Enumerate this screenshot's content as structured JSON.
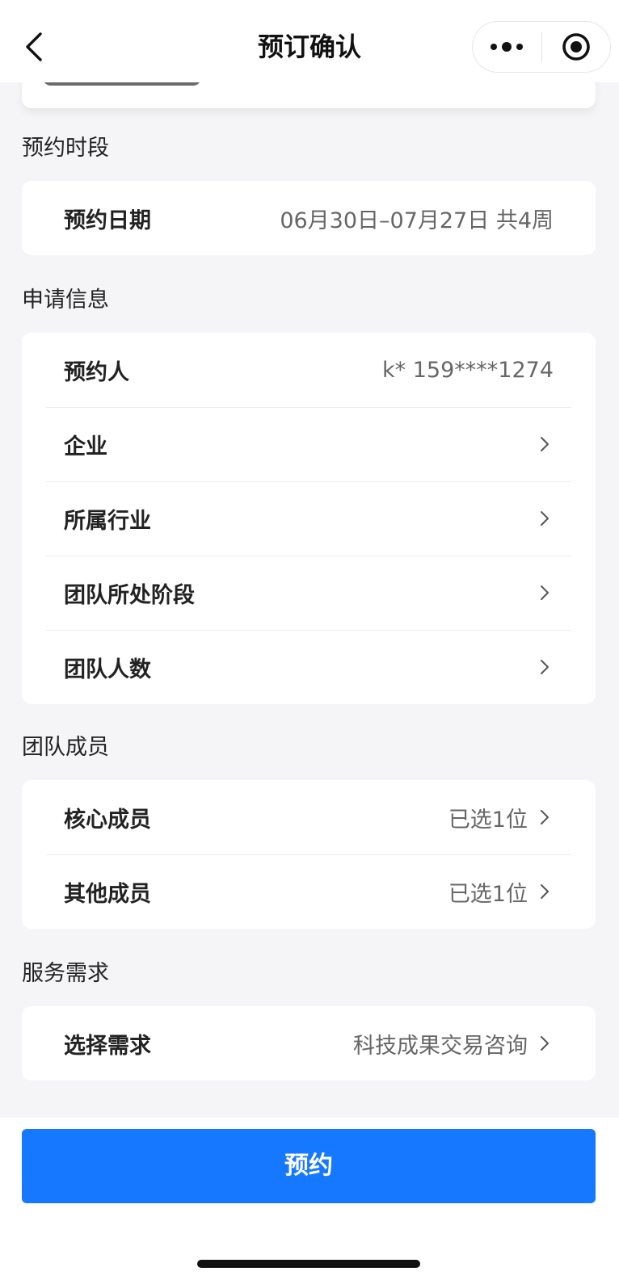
{
  "nav": {
    "title": "预订确认"
  },
  "schedule": {
    "section_title": "预约时段",
    "date_label": "预约日期",
    "date_value": "06月30日–07月27日 共4周"
  },
  "application": {
    "section_title": "申请信息",
    "rows": [
      {
        "label": "预约人",
        "value": "k* 159****1274"
      },
      {
        "label": "企业",
        "value": ""
      },
      {
        "label": "所属行业",
        "value": ""
      },
      {
        "label": "团队所处阶段",
        "value": ""
      },
      {
        "label": "团队人数",
        "value": ""
      }
    ]
  },
  "team": {
    "section_title": "团队成员",
    "rows": [
      {
        "label": "核心成员",
        "value": "已选1位"
      },
      {
        "label": "其他成员",
        "value": "已选1位"
      }
    ]
  },
  "service": {
    "section_title": "服务需求",
    "label": "选择需求",
    "value": "科技成果交易咨询"
  },
  "actions": {
    "submit_label": "预约"
  }
}
